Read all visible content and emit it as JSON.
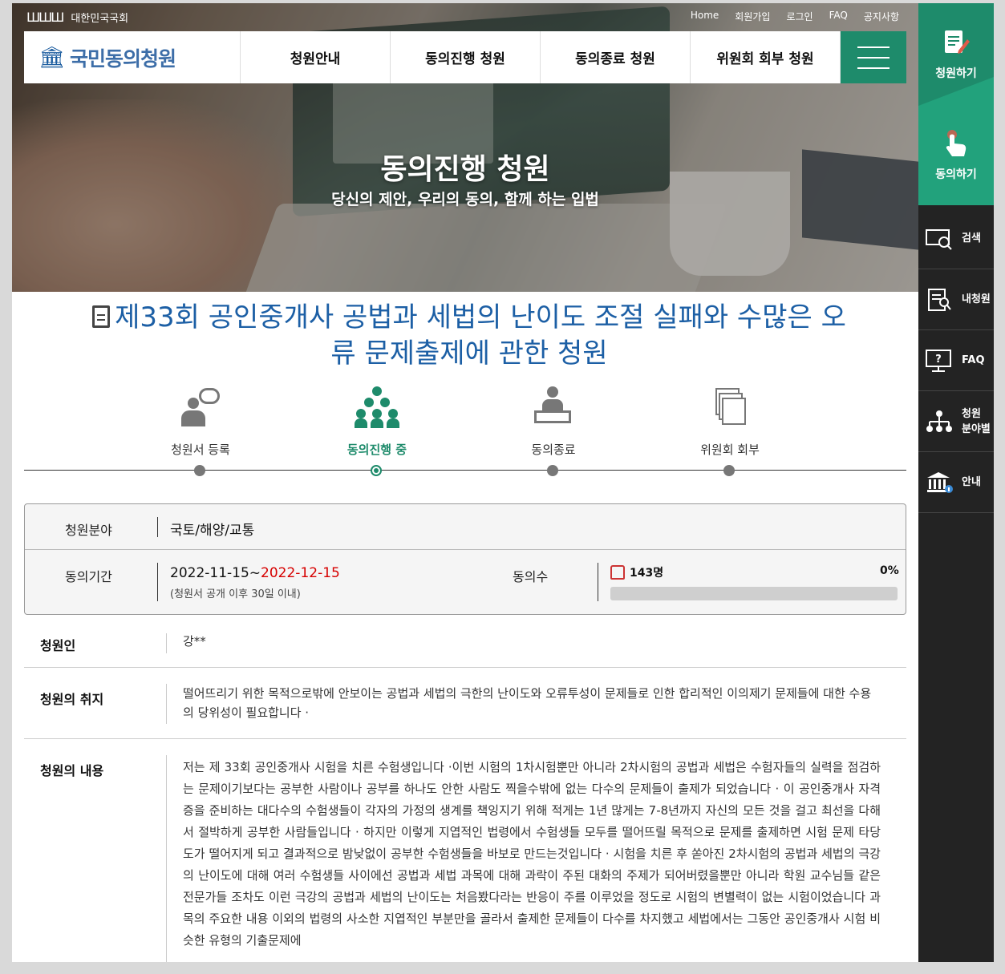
{
  "gov": {
    "logo_text": "대한민국국회"
  },
  "util_nav": [
    "Home",
    "회원가입",
    "로그인",
    "FAQ",
    "공지사항"
  ],
  "logo": {
    "text": "국민동의청원"
  },
  "nav": [
    "청원안내",
    "동의진행 청원",
    "동의종료 청원",
    "위원회 회부 청원"
  ],
  "hero": {
    "title": "동의진행 청원",
    "subtitle": "당신의 제안, 우리의 동의, 함께 하는 입법"
  },
  "petition": {
    "title": "제33회 공인중개사 공법과 세법의 난이도 조절 실패와 수많은 오류 문제출제에 관한 청원"
  },
  "steps": [
    {
      "label": "청원서 등록",
      "active": false
    },
    {
      "label": "동의진행 중",
      "active": true
    },
    {
      "label": "동의종료",
      "active": false
    },
    {
      "label": "위원회 회부",
      "active": false
    }
  ],
  "info": {
    "field_label": "청원분야",
    "field_value": "국토/해양/교통",
    "period_label": "동의기간",
    "period_start": "2022-11-15~",
    "period_end": "2022-12-15",
    "period_note": "(청원서 공개 이후 30일 이내)",
    "count_label": "동의수",
    "count_value": "143명",
    "percent_text": "0%",
    "progress": 0
  },
  "details": {
    "petitioner_label": "청원인",
    "petitioner_value": "강**",
    "purpose_label": "청원의 취지",
    "purpose_text": "떨어뜨리기 위한 목적으로밖에 안보이는 공법과 세법의 극한의 난이도와 오류투성이 문제들로 인한 합리적인 이의제기 문제들에 대한 수용의 당위성이 필요합니다 ·",
    "content_label": "청원의 내용",
    "content_text": "저는 제 33회 공인중개사 시험을 치른 수험생입니다 ·이번 시험의 1차시험뿐만 아니라 2차시험의 공법과 세법은 수험자들의 실력을 점검하는 문제이기보다는 공부한 사람이나 공부를 하나도 안한 사람도 찍을수밖에 없는 다수의 문제들이 출제가 되었습니다 · 이 공인중개사 자격증을 준비하는 대다수의 수험생들이 각자의 가정의 생계를 책잉지기 위해 적게는 1년 많게는 7-8년까지 자신의 모든 것을 걸고 최선을 다해서 절박하게 공부한 사람들입니다 · 하지만 이렇게 지엽적인 법령에서 수험생들 모두를 떨어뜨릴 목적으로 문제를 출제하면 시험 문제 타당도가 떨어지게 되고 결과적으로 밤낮없이 공부한 수험생들을 바보로 만드는것입니다 · 시험을 치른 후 쏟아진 2차시험의 공법과 세법의 극강의 난이도에 대해 여러 수험생들 사이에선 공법과 세법 과목에 대해 과락이 주된 대화의 주제가 되어버렸을뿐만 아니라 학원 교수님들 같은 전문가들 조차도 이런 극강의 공법과 세법의 난이도는 처음봤다라는 반응이 주를 이루었을 정도로 시험의 변별력이 없는 시험이었습니다 과목의 주요한 내용 이외의 법령의 사소한 지엽적인 부분만을 골라서 출제한 문제들이 다수를 차지했고 세법에서는 그동안 공인중개사 시험 비슷한 유형의 기출문제에"
  },
  "sidebar": {
    "write_label": "청원하기",
    "agree_label": "동의하기",
    "items": [
      {
        "icon": "search-icon",
        "label": "검색"
      },
      {
        "icon": "my-petition-icon",
        "label": "내청원"
      },
      {
        "icon": "faq-icon",
        "label": "FAQ"
      },
      {
        "icon": "org-chart-icon",
        "label": "청원 분야별"
      },
      {
        "icon": "building-info-icon",
        "label": "안내"
      }
    ]
  },
  "colors": {
    "accent_green": "#1e8b6b",
    "title_blue": "#1c5fa5",
    "deadline_red": "#d60000"
  }
}
